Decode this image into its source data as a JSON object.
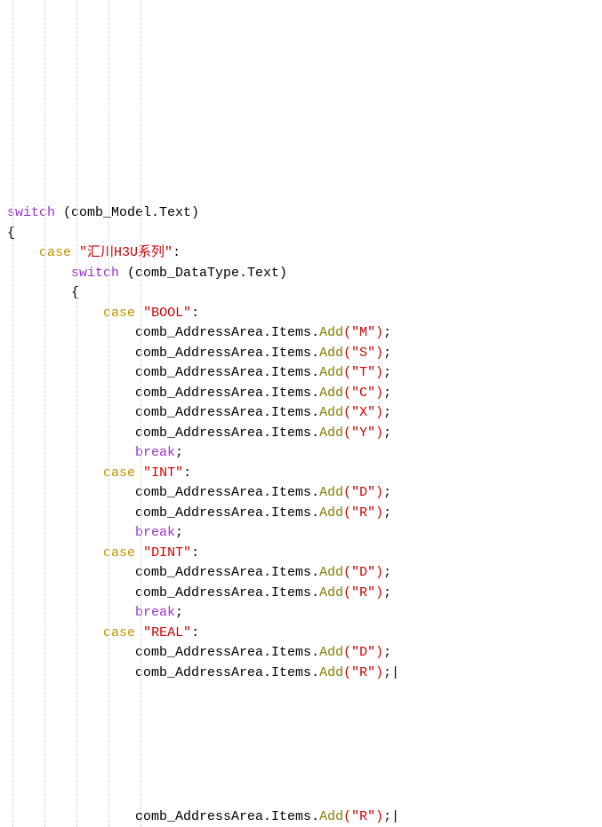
{
  "code": {
    "k_switch": "switch",
    "k_case": "case",
    "k_break": "break",
    "outer_expr": " (comb_Model.Text)",
    "lbrace": "{",
    "rbrace": "}",
    "colon": ":",
    "semi": ";",
    "inner_expr": " (comb_DataType.Text)",
    "case_outer_1": "\"汇川H3U系列\"",
    "call_prefix": "comb_AddressArea.Items.",
    "m_add": "Add",
    "case_bool": "\"BOOL\"",
    "case_int": "\"INT\"",
    "case_dint": "\"DINT\"",
    "case_real": "\"REAL\"",
    "arg_m": "(\"M\")",
    "arg_s": "(\"S\")",
    "arg_t": "(\"T\")",
    "arg_c": "(\"C\")",
    "arg_x": "(\"X\")",
    "arg_y": "(\"Y\")",
    "arg_d": "(\"D\")",
    "arg_r": "(\"R\")",
    "cursor": "|"
  }
}
